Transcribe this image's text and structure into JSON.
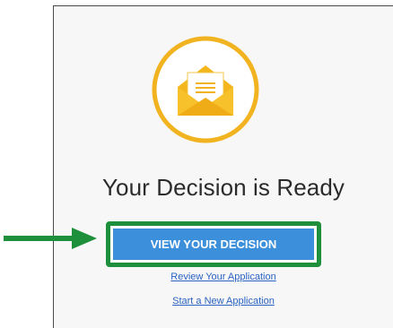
{
  "decision": {
    "title": "Your Decision is Ready",
    "view_button_label": "VIEW YOUR DECISION",
    "review_link": "Review Your Application",
    "new_link": "Start a New Application"
  },
  "icon": {
    "name": "envelope-letter-icon",
    "ring_color": "#f1b320",
    "envelope_color": "#f3b61c"
  },
  "annotation": {
    "arrow_color": "#1e8f3a",
    "highlight_color": "#1e8f3a"
  },
  "colors": {
    "button_bg": "#3c8fdb",
    "link": "#2a62c2",
    "title": "#2b2b2b"
  }
}
